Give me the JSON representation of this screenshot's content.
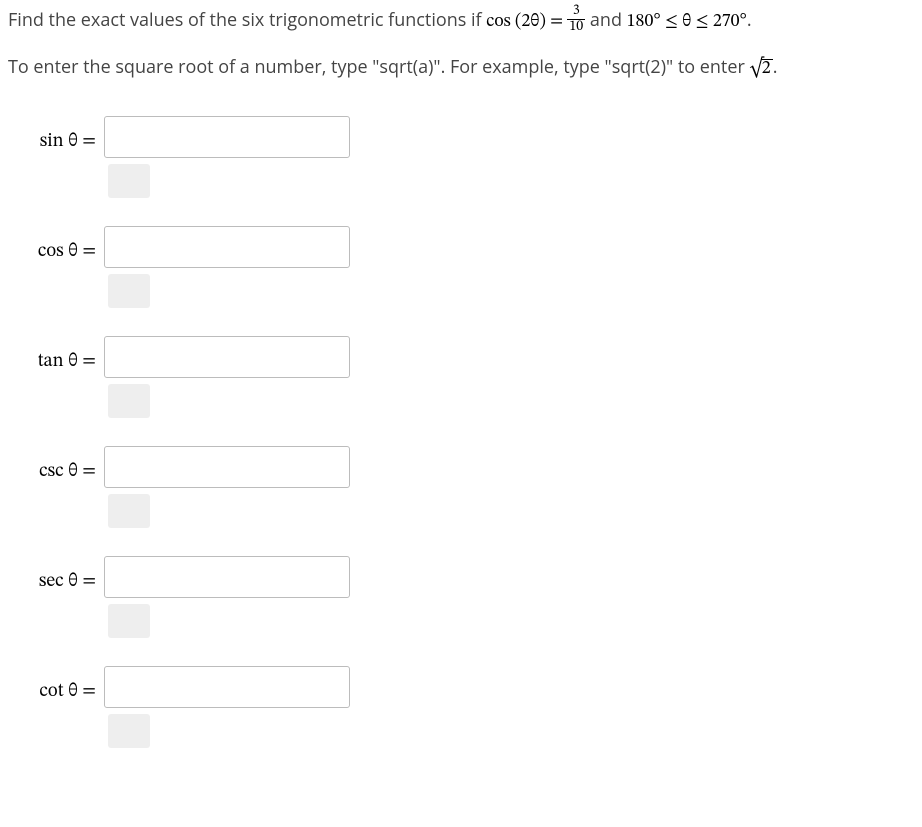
{
  "problem": {
    "pre_text": "Find the exact values of the six trigonometric functions if ",
    "cos_expr": "cos (2θ) = ",
    "frac_num": "3",
    "frac_den": "10",
    "mid_text": " and ",
    "range_expr": "180° ≤ θ ≤ 270°",
    "post_text": "."
  },
  "hint": {
    "pre": "To enter the square root of a number, type \"sqrt(a)\". For example, type \"sqrt(2)\" to enter ",
    "sqrt_radicand": "2",
    "post": "."
  },
  "rows": [
    {
      "label": "sin θ =",
      "value": ""
    },
    {
      "label": "cos θ =",
      "value": ""
    },
    {
      "label": "tan θ =",
      "value": ""
    },
    {
      "label": "csc θ =",
      "value": ""
    },
    {
      "label": "sec θ =",
      "value": ""
    },
    {
      "label": "cot θ =",
      "value": ""
    }
  ]
}
